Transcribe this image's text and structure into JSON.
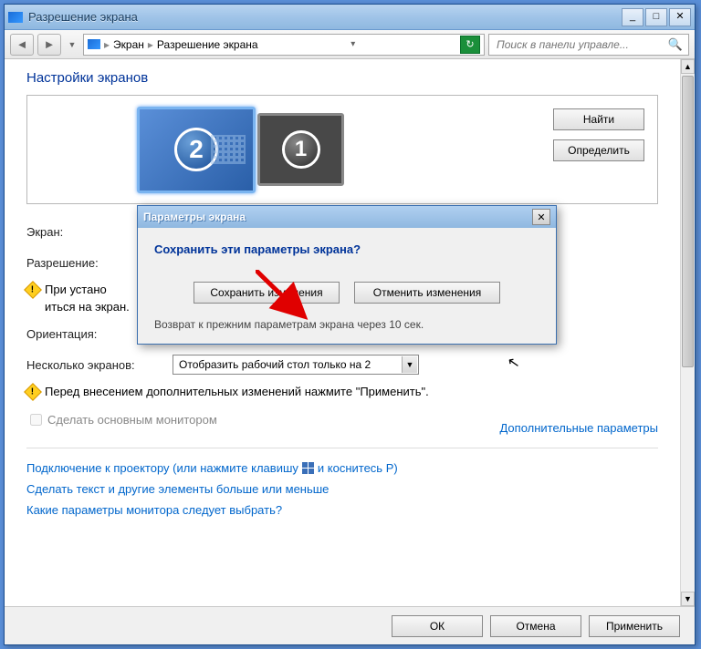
{
  "window": {
    "title": "Разрешение экрана"
  },
  "breadcrumb": {
    "level1": "Экран",
    "level2": "Разрешение экрана"
  },
  "search": {
    "placeholder": "Поиск в панели управле..."
  },
  "main": {
    "heading": "Настройки экранов",
    "monitor_active": "2",
    "monitor_inactive": "1",
    "find_btn": "Найти",
    "identify_btn": "Определить",
    "labels": {
      "screen": "Экран:",
      "resolution": "Разрешение:",
      "orientation": "Ориентация:",
      "multiple": "Несколько экранов:"
    },
    "warn_resolution": "При устано",
    "warn_resolution_end": "иться на экран.",
    "multi_select_value": "Отобразить рабочий стол только на 2",
    "warn_apply": "Перед внесением дополнительных изменений нажмите \"Применить\".",
    "make_primary": "Сделать основным монитором",
    "advanced": "Дополнительные параметры",
    "links": {
      "projector_pre": "Подключение к проектору (или нажмите клавишу",
      "projector_post": "и коснитесь P)",
      "textsize": "Сделать текст и другие элементы больше или меньше",
      "which_monitor": "Какие параметры монитора следует выбрать?"
    },
    "ok": "ОК",
    "cancel": "Отмена",
    "apply": "Применить"
  },
  "dialog": {
    "title": "Параметры экрана",
    "question": "Сохранить эти параметры экрана?",
    "save": "Сохранить изменения",
    "revert": "Отменить изменения",
    "countdown": "Возврат к прежним параметрам экрана через 10 сек."
  }
}
